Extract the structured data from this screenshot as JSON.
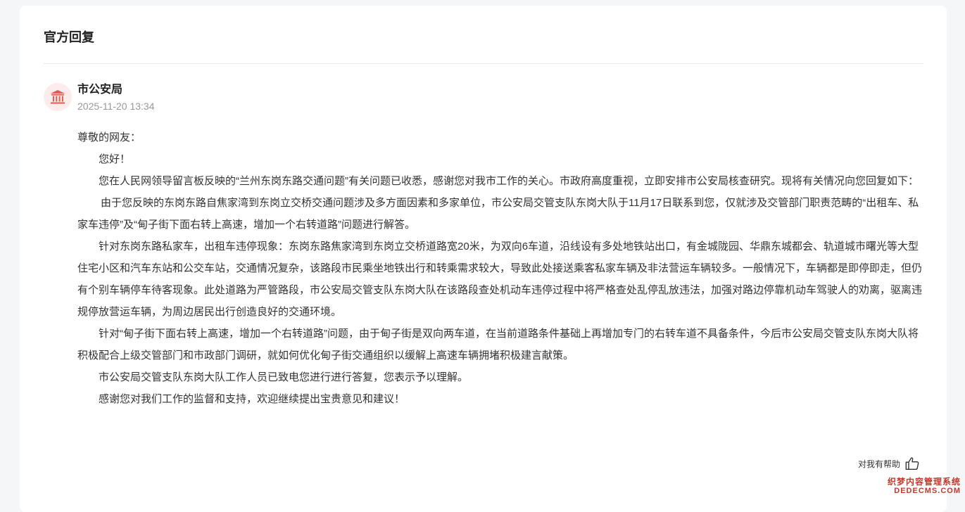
{
  "section": {
    "title": "官方回复"
  },
  "reply": {
    "department": "市公安局",
    "timestamp": "2025-11-20 13:34",
    "avatar_icon": "government-building-icon",
    "greeting": "尊敬的网友：",
    "paragraphs": [
      "您好！",
      "您在人民网领导留言板反映的“兰州东岗东路交通问题”有关问题已收悉，感谢您对我市工作的关心。市政府高度重视，立即安排市公安局核查研究。现将有关情况向您回复如下：",
      "由于您反映的东岗东路自焦家湾到东岗立交桥交通问题涉及多方面因素和多家单位，市公安局交管支队东岗大队于11月17日联系到您，仅就涉及交管部门职责范畴的“出租车、私家车违停”及“甸子街下面右转上高速，增加一个右转道路”问题进行解答。",
      "针对东岗东路私家车，出租车违停现象：东岗东路焦家湾到东岗立交桥道路宽20米，为双向6车道，沿线设有多处地铁站出口，有金城陇园、华鼎东城都会、轨道城市曙光等大型住宅小区和汽车东站和公交车站，交通情况复杂，该路段市民乘坐地铁出行和转乘需求较大，导致此处接送乘客私家车辆及非法营运车辆较多。一般情况下，车辆都是即停即走，但仍有个别车辆停车待客现象。此处道路为严管路段，市公安局交管支队东岗大队在该路段查处机动车违停过程中将严格查处乱停乱放违法，加强对路边停靠机动车驾驶人的劝离，驱离违规停放营运车辆，为周边居民出行创造良好的交通环境。",
      "针对“甸子街下面右转上高速，增加一个右转道路”问题，由于甸子街是双向两车道，在当前道路条件基础上再增加专门的右转车道不具备条件，今后市公安局交管支队东岗大队将积极配合上级交管部门和市政部门调研，就如何优化甸子街交通组织以缓解上高速车辆拥堵积极建言献策。",
      "市公安局交管支队东岗大队工作人员已致电您进行进行答复，您表示予以理解。",
      "感谢您对我们工作的监督和支持，欢迎继续提出宝贵意见和建议！"
    ]
  },
  "feedback": {
    "helpful_label": "对我有帮助",
    "icon": "thumbs-up-icon"
  },
  "watermark": {
    "line1": "织梦内容管理系统",
    "line2": "DEDECMS.COM"
  },
  "colors": {
    "accent": "#e25b4f",
    "avatar_bg": "#fdeceb"
  }
}
